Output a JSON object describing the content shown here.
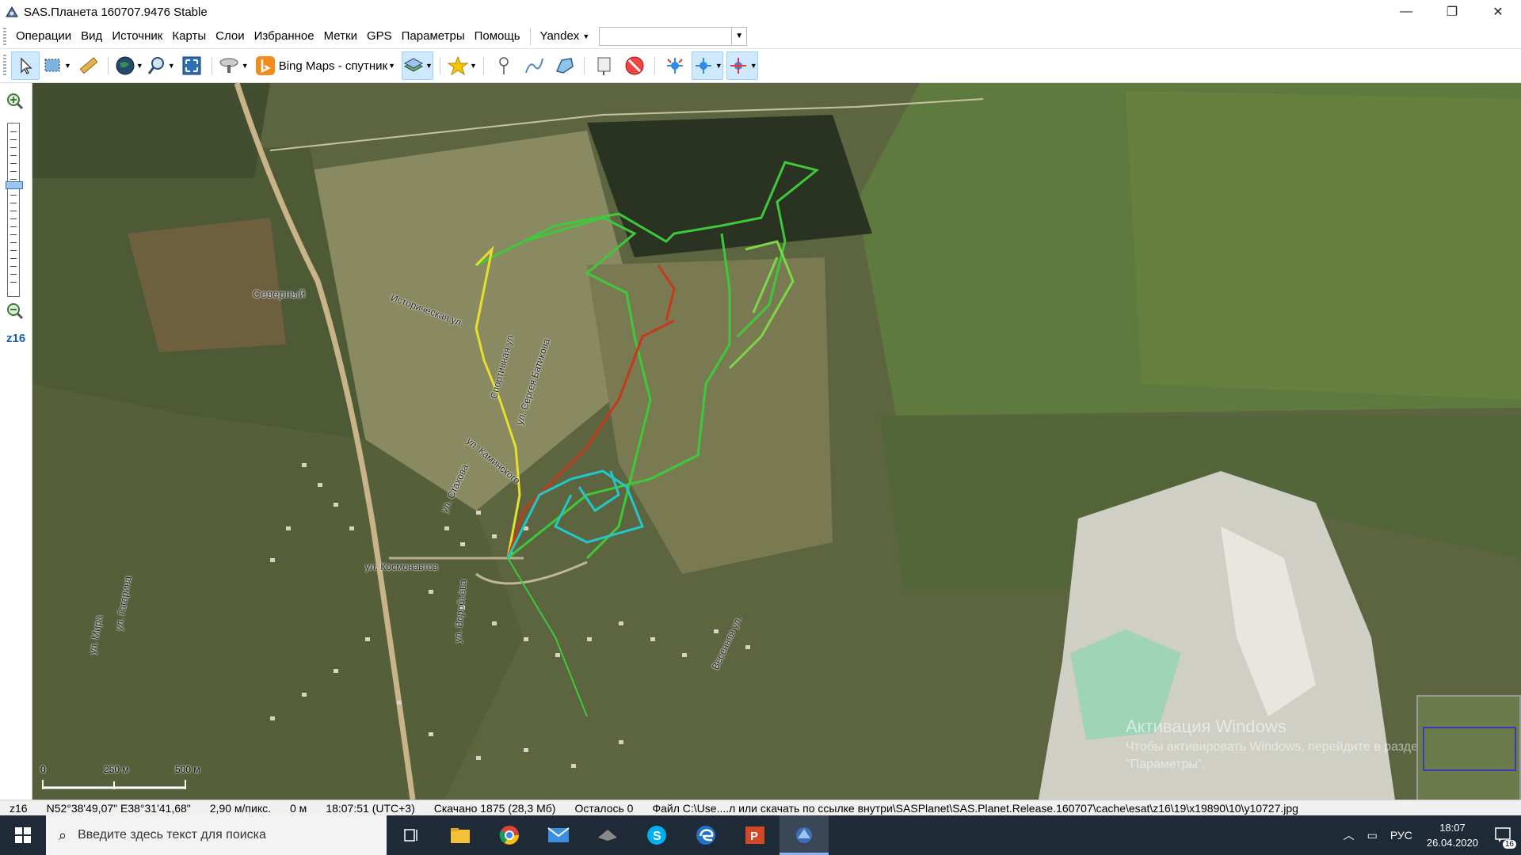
{
  "window": {
    "title": "SAS.Планета 160707.9476 Stable",
    "controls": {
      "minimize": "—",
      "maximize": "❐",
      "close": "✕"
    }
  },
  "menu": {
    "items": [
      "Операции",
      "Вид",
      "Источник",
      "Карты",
      "Слои",
      "Избранное",
      "Метки",
      "GPS",
      "Параметры",
      "Помощь"
    ],
    "search_provider": "Yandex",
    "search_value": ""
  },
  "toolbar": {
    "map_source": "Bing Maps - спутник",
    "icons": [
      "cursor-icon",
      "select-area-icon",
      "ruler-icon",
      "globe-icon",
      "zoom-search-icon",
      "fullscreen-icon",
      "satellite-dish-icon",
      "bing-icon",
      "layers-icon",
      "star-icon",
      "placemark-icon",
      "path-icon",
      "polygon-icon",
      "marks-icon",
      "stop-icon",
      "gps-icon",
      "gps-track-icon",
      "gps-center-icon"
    ]
  },
  "zoombar": {
    "zoom_label": "z16"
  },
  "map": {
    "place_label": "Северный",
    "streets": [
      "Историческая ул.",
      "Спортивная ул.",
      "ул. Сергея Батикова",
      "ул. Каминского",
      "ул. Стахова",
      "ул. Космонавтов",
      "ул. Гагарина",
      "ул. Мира",
      "ул. Воробьёва",
      "Весенняя ул."
    ],
    "scale": {
      "labels": [
        "0",
        "250 м",
        "500 м"
      ]
    },
    "watermark": {
      "line1": "Активация Windows",
      "line2": "Чтобы активировать Windows, перейдите в раздел",
      "line3": "\"Параметры\"."
    },
    "track_colors": {
      "green": "#3ec93a",
      "light_green": "#8fe04a",
      "yellow": "#e6e02a",
      "red": "#c53a1a",
      "cyan": "#22c8c8"
    }
  },
  "status": {
    "zoom": "z16",
    "coords": "N52°38'49,07\" E38°31'41,68\"",
    "resolution": "2,90 м/пикс.",
    "distance": "0 м",
    "time": "18:07:51 (UTC+3)",
    "downloaded": "Скачано 1875 (28,3 Мб)",
    "remaining": "Осталось 0",
    "file": "Файл C:\\Use....л или скачать по ссылке внутри\\SASPlanet\\SAS.Planet.Release.160707\\cache\\esat\\z16\\19\\x19890\\10\\y10727.jpg"
  },
  "taskbar": {
    "search_placeholder": "Введите здесь текст для поиска",
    "language": "РУС",
    "time": "18:07",
    "date": "26.04.2020",
    "notifications": "16"
  }
}
